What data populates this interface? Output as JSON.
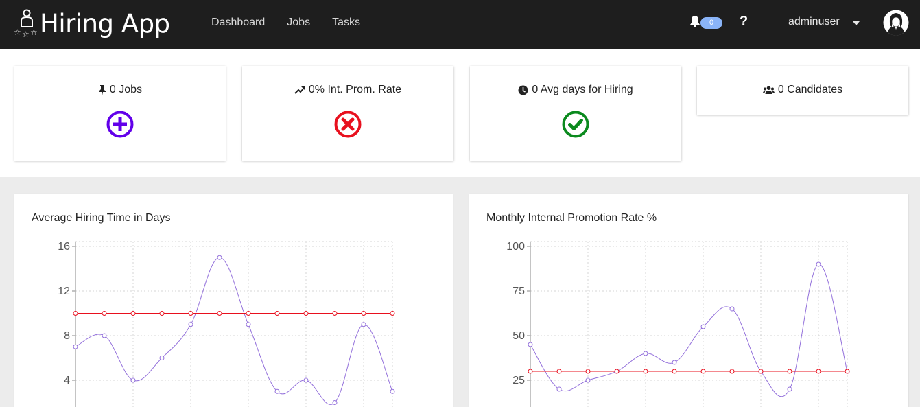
{
  "header": {
    "app_title": "Hiring App",
    "nav": [
      "Dashboard",
      "Jobs",
      "Tasks"
    ],
    "notifications_count": "0",
    "help_label": "?",
    "username": "adminuser",
    "icons": [
      "app-logo-icon",
      "bell-icon",
      "caret-down-icon",
      "user-avatar-icon"
    ]
  },
  "kpis": [
    {
      "label": "0 Jobs",
      "icon": "pin-icon",
      "status_icon": "plus-circle-icon",
      "status_color": "#6200ea"
    },
    {
      "label": "0% Int. Prom. Rate",
      "icon": "trend-up-icon",
      "status_icon": "times-circle-icon",
      "status_color": "#e8101e"
    },
    {
      "label": "0 Avg days for Hiring",
      "icon": "clock-icon",
      "status_icon": "check-circle-icon",
      "status_color": "#0b8a1e"
    },
    {
      "label": "0 Candidates",
      "icon": "users-icon"
    }
  ],
  "chart_data": [
    {
      "type": "line",
      "title": "Average Hiring Time in Days",
      "yticks": [
        4,
        8,
        12,
        16
      ],
      "ylim": [
        0,
        16.5
      ],
      "grid": true,
      "series": [
        {
          "values": [
            7,
            8,
            4,
            6,
            9,
            15,
            9,
            3,
            4,
            2,
            9,
            3
          ],
          "color": "#9370db",
          "curve": "smooth"
        },
        {
          "values": [
            10,
            10,
            10,
            10,
            10,
            10,
            10,
            10,
            10,
            10,
            10,
            10
          ],
          "color": "#e8101e",
          "curve": "straight"
        }
      ]
    },
    {
      "type": "line",
      "title": "Monthly Internal Promotion Rate %",
      "yticks": [
        25,
        50,
        75,
        100
      ],
      "ylim": [
        0,
        103
      ],
      "grid": true,
      "series": [
        {
          "values": [
            45,
            20,
            25,
            30,
            40,
            35,
            55,
            65,
            30,
            20,
            90,
            30
          ],
          "color": "#9370db",
          "curve": "smooth"
        },
        {
          "values": [
            30,
            30,
            30,
            30,
            30,
            30,
            30,
            30,
            30,
            30,
            30,
            30
          ],
          "color": "#e8101e",
          "curve": "straight"
        }
      ]
    }
  ]
}
